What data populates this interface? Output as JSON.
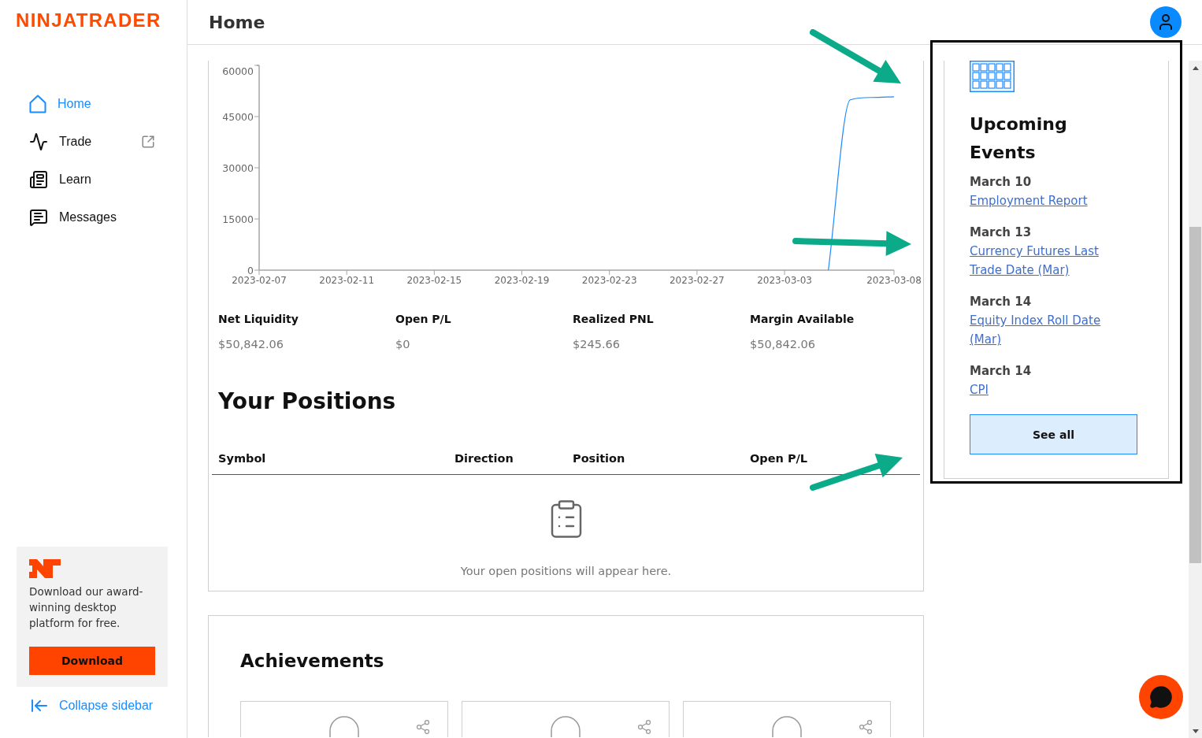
{
  "sidebar": {
    "logo": "NINJATRADER",
    "nav": [
      {
        "label": "Home",
        "kind": "home",
        "selected": true,
        "external": false
      },
      {
        "label": "Trade",
        "kind": "trade",
        "selected": false,
        "external": true
      },
      {
        "label": "Learn",
        "kind": "learn",
        "selected": false,
        "external": false
      },
      {
        "label": "Messages",
        "kind": "messages",
        "selected": false,
        "external": false
      }
    ],
    "promo": {
      "text": "Download our award-winning desktop platform for free.",
      "button": "Download"
    },
    "collapse": "Collapse sidebar"
  },
  "header": {
    "title": "Home"
  },
  "account": {
    "chart_data": {
      "type": "line",
      "categories": [
        "2023-02-07",
        null,
        null,
        null,
        "2023-02-11",
        null,
        null,
        null,
        "2023-02-15",
        null,
        null,
        null,
        "2023-02-19",
        null,
        null,
        null,
        "2023-02-23",
        null,
        null,
        null,
        "2023-02-27",
        null,
        null,
        null,
        "2023-03-03",
        null,
        null,
        null,
        null,
        "2023-03-08"
      ],
      "values": [
        null,
        null,
        null,
        null,
        null,
        null,
        null,
        null,
        null,
        null,
        null,
        null,
        null,
        null,
        null,
        null,
        null,
        null,
        null,
        null,
        null,
        null,
        null,
        null,
        null,
        null,
        0,
        49900,
        50600,
        50800
      ],
      "ylim": [
        0,
        60000
      ],
      "yticks": [
        0,
        15000,
        30000,
        45000,
        60000
      ]
    },
    "stats": [
      {
        "label": "Net Liquidity",
        "value": "$50,842.06"
      },
      {
        "label": "Open P/L",
        "value": "$0"
      },
      {
        "label": "Realized PNL",
        "value": "$245.66"
      },
      {
        "label": "Margin Available",
        "value": "$50,842.06"
      }
    ],
    "positions": {
      "title": "Your Positions",
      "columns": [
        "Symbol",
        "Direction",
        "Position",
        "Open P/L"
      ],
      "empty_message": "Your open positions will appear here."
    }
  },
  "achievements": {
    "title": "Achievements",
    "tiles": [
      {
        "kind": "badge"
      },
      {
        "kind": "badge"
      },
      {
        "kind": "badge"
      }
    ]
  },
  "events": {
    "title": "Upcoming Events",
    "items": [
      {
        "date": "March 10",
        "name": "Employment Report"
      },
      {
        "date": "March 13",
        "name": "Currency Futures Last Trade Date (Mar)"
      },
      {
        "date": "March 14",
        "name": "Equity Index Roll Date (Mar)"
      },
      {
        "date": "March 14",
        "name": "CPI"
      }
    ],
    "button": "See all"
  }
}
